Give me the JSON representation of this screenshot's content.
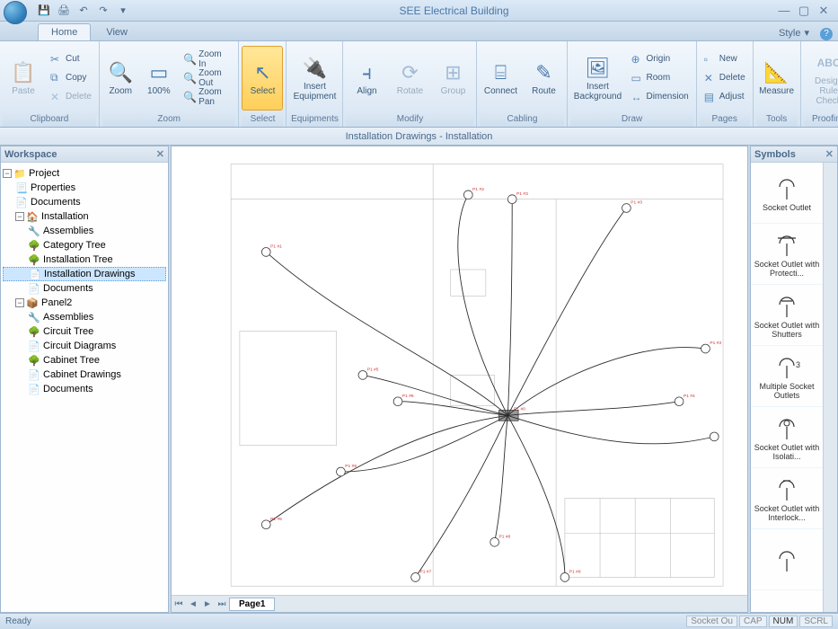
{
  "app": {
    "title": "SEE Electrical Building",
    "style_label": "Style"
  },
  "tabs": {
    "home": "Home",
    "view": "View"
  },
  "ribbon": {
    "clipboard": {
      "title": "Clipboard",
      "paste": "Paste",
      "cut": "Cut",
      "copy": "Copy",
      "delete": "Delete"
    },
    "zoom": {
      "title": "Zoom",
      "zoom": "Zoom",
      "hundred": "100%",
      "in": "Zoom In",
      "out": "Zoom Out",
      "pan": "Zoom Pan"
    },
    "select": {
      "title": "Select",
      "select": "Select"
    },
    "equipments": {
      "title": "Equipments",
      "insert": "Insert\nEquipment"
    },
    "modify": {
      "title": "Modify",
      "align": "Align",
      "rotate": "Rotate",
      "group": "Group"
    },
    "cabling": {
      "title": "Cabling",
      "connect": "Connect",
      "route": "Route"
    },
    "draw": {
      "title": "Draw",
      "bg": "Insert\nBackground",
      "origin": "Origin",
      "room": "Room",
      "dimension": "Dimension"
    },
    "pages": {
      "title": "Pages",
      "new": "New",
      "delete": "Delete",
      "adjust": "Adjust"
    },
    "tools": {
      "title": "Tools",
      "measure": "Measure"
    },
    "proofing": {
      "title": "Proofing",
      "drc": "Design\nRule Check"
    }
  },
  "docbar": "Installation Drawings - Installation",
  "workspace": {
    "title": "Workspace",
    "project": "Project",
    "properties": "Properties",
    "documents": "Documents",
    "installation": "Installation",
    "assemblies": "Assemblies",
    "category_tree": "Category Tree",
    "installation_tree": "Installation Tree",
    "installation_drawings": "Installation Drawings",
    "panel2": "Panel2",
    "circuit_tree": "Circuit Tree",
    "circuit_diagrams": "Circuit Diagrams",
    "cabinet_tree": "Cabinet Tree",
    "cabinet_drawings": "Cabinet Drawings"
  },
  "symbols": {
    "title": "Symbols",
    "items": [
      "Socket Outlet",
      "Socket Outlet with Protecti...",
      "Socket Outlet with Shutters",
      "Multiple Socket Outlets",
      "Socket Outlet with Isolati...",
      "Socket Outlet with Interlock..."
    ],
    "multi_annotation": "3"
  },
  "page_tab": "Page1",
  "status": {
    "ready": "Ready",
    "socket": "Socket Ou",
    "cap": "CAP",
    "num": "NUM",
    "scrl": "SCRL"
  }
}
